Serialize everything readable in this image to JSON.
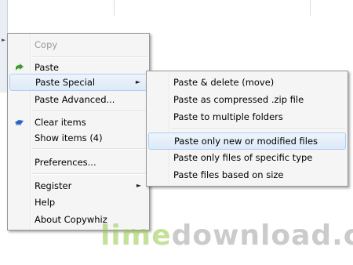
{
  "main_menu": {
    "items": [
      {
        "label": "Copy",
        "disabled": true
      },
      {
        "label": "Paste"
      },
      {
        "label": "Paste Special"
      },
      {
        "label": "Paste Advanced..."
      },
      {
        "label": "Clear items"
      },
      {
        "label": "Show items (4)"
      },
      {
        "label": "Preferences..."
      },
      {
        "label": "Register"
      },
      {
        "label": "Help"
      },
      {
        "label": "About Copywhiz"
      }
    ],
    "highlighted": "Paste Special"
  },
  "submenu": {
    "items": [
      {
        "label": "Paste & delete (move)"
      },
      {
        "label": "Paste as compressed .zip file"
      },
      {
        "label": "Paste to multiple folders"
      },
      {
        "label": "Paste only new or modified files"
      },
      {
        "label": "Paste only files of specific type"
      },
      {
        "label": "Paste files based on size"
      }
    ],
    "highlighted": "Paste only new or modified files"
  },
  "watermark": {
    "part1": "lime",
    "part2": "download.com"
  },
  "colors": {
    "highlight_border": "#aecff7",
    "paste_icon": "#3a9b2c",
    "clear_icon": "#2a62c9"
  }
}
